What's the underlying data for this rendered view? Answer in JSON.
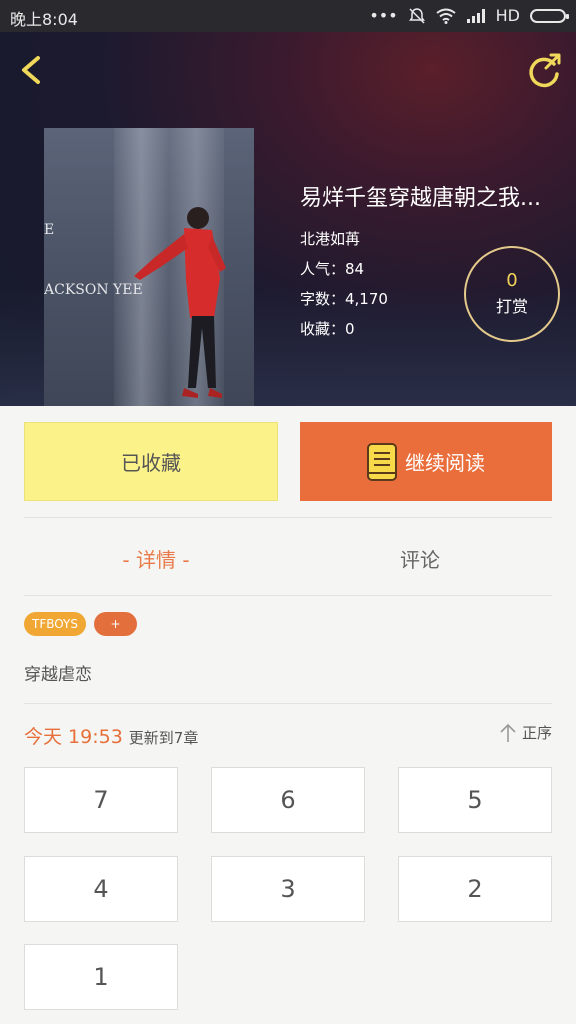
{
  "status_bar": {
    "time": "晚上8:04",
    "network": "HD",
    "icons": [
      "more-dots-icon",
      "mute-icon",
      "wifi-icon",
      "signal-icon",
      "battery-icon"
    ]
  },
  "book": {
    "title": "易烊千玺穿越唐朝之我...",
    "author": "北港如苒",
    "popularity": "人气：84",
    "word_count": "字数：4,170",
    "favorites": "收藏：0",
    "cover_text_top": "E",
    "cover_text": "ACKSON YEE"
  },
  "tip": {
    "count": "0",
    "label": "打赏"
  },
  "actions": {
    "favorited_label": "已收藏",
    "continue_label": "继续阅读"
  },
  "tabs": [
    {
      "label": "- 详情 -",
      "active": true
    },
    {
      "label": "评论",
      "active": false
    }
  ],
  "tags": [
    {
      "label": "TFBOYS"
    },
    {
      "label": "+"
    }
  ],
  "description": "穿越虐恋",
  "update": {
    "date": "今天 19:53",
    "text": "更新到7章",
    "sort_label": "正序"
  },
  "chapters": [
    "7",
    "6",
    "5",
    "4",
    "3",
    "2",
    "1"
  ],
  "colors": {
    "accent_orange": "#ea6e3b",
    "favorite_yellow": "#fbf28a",
    "tag_orange": "#f0a733",
    "tip_gold": "#e3c98a"
  }
}
